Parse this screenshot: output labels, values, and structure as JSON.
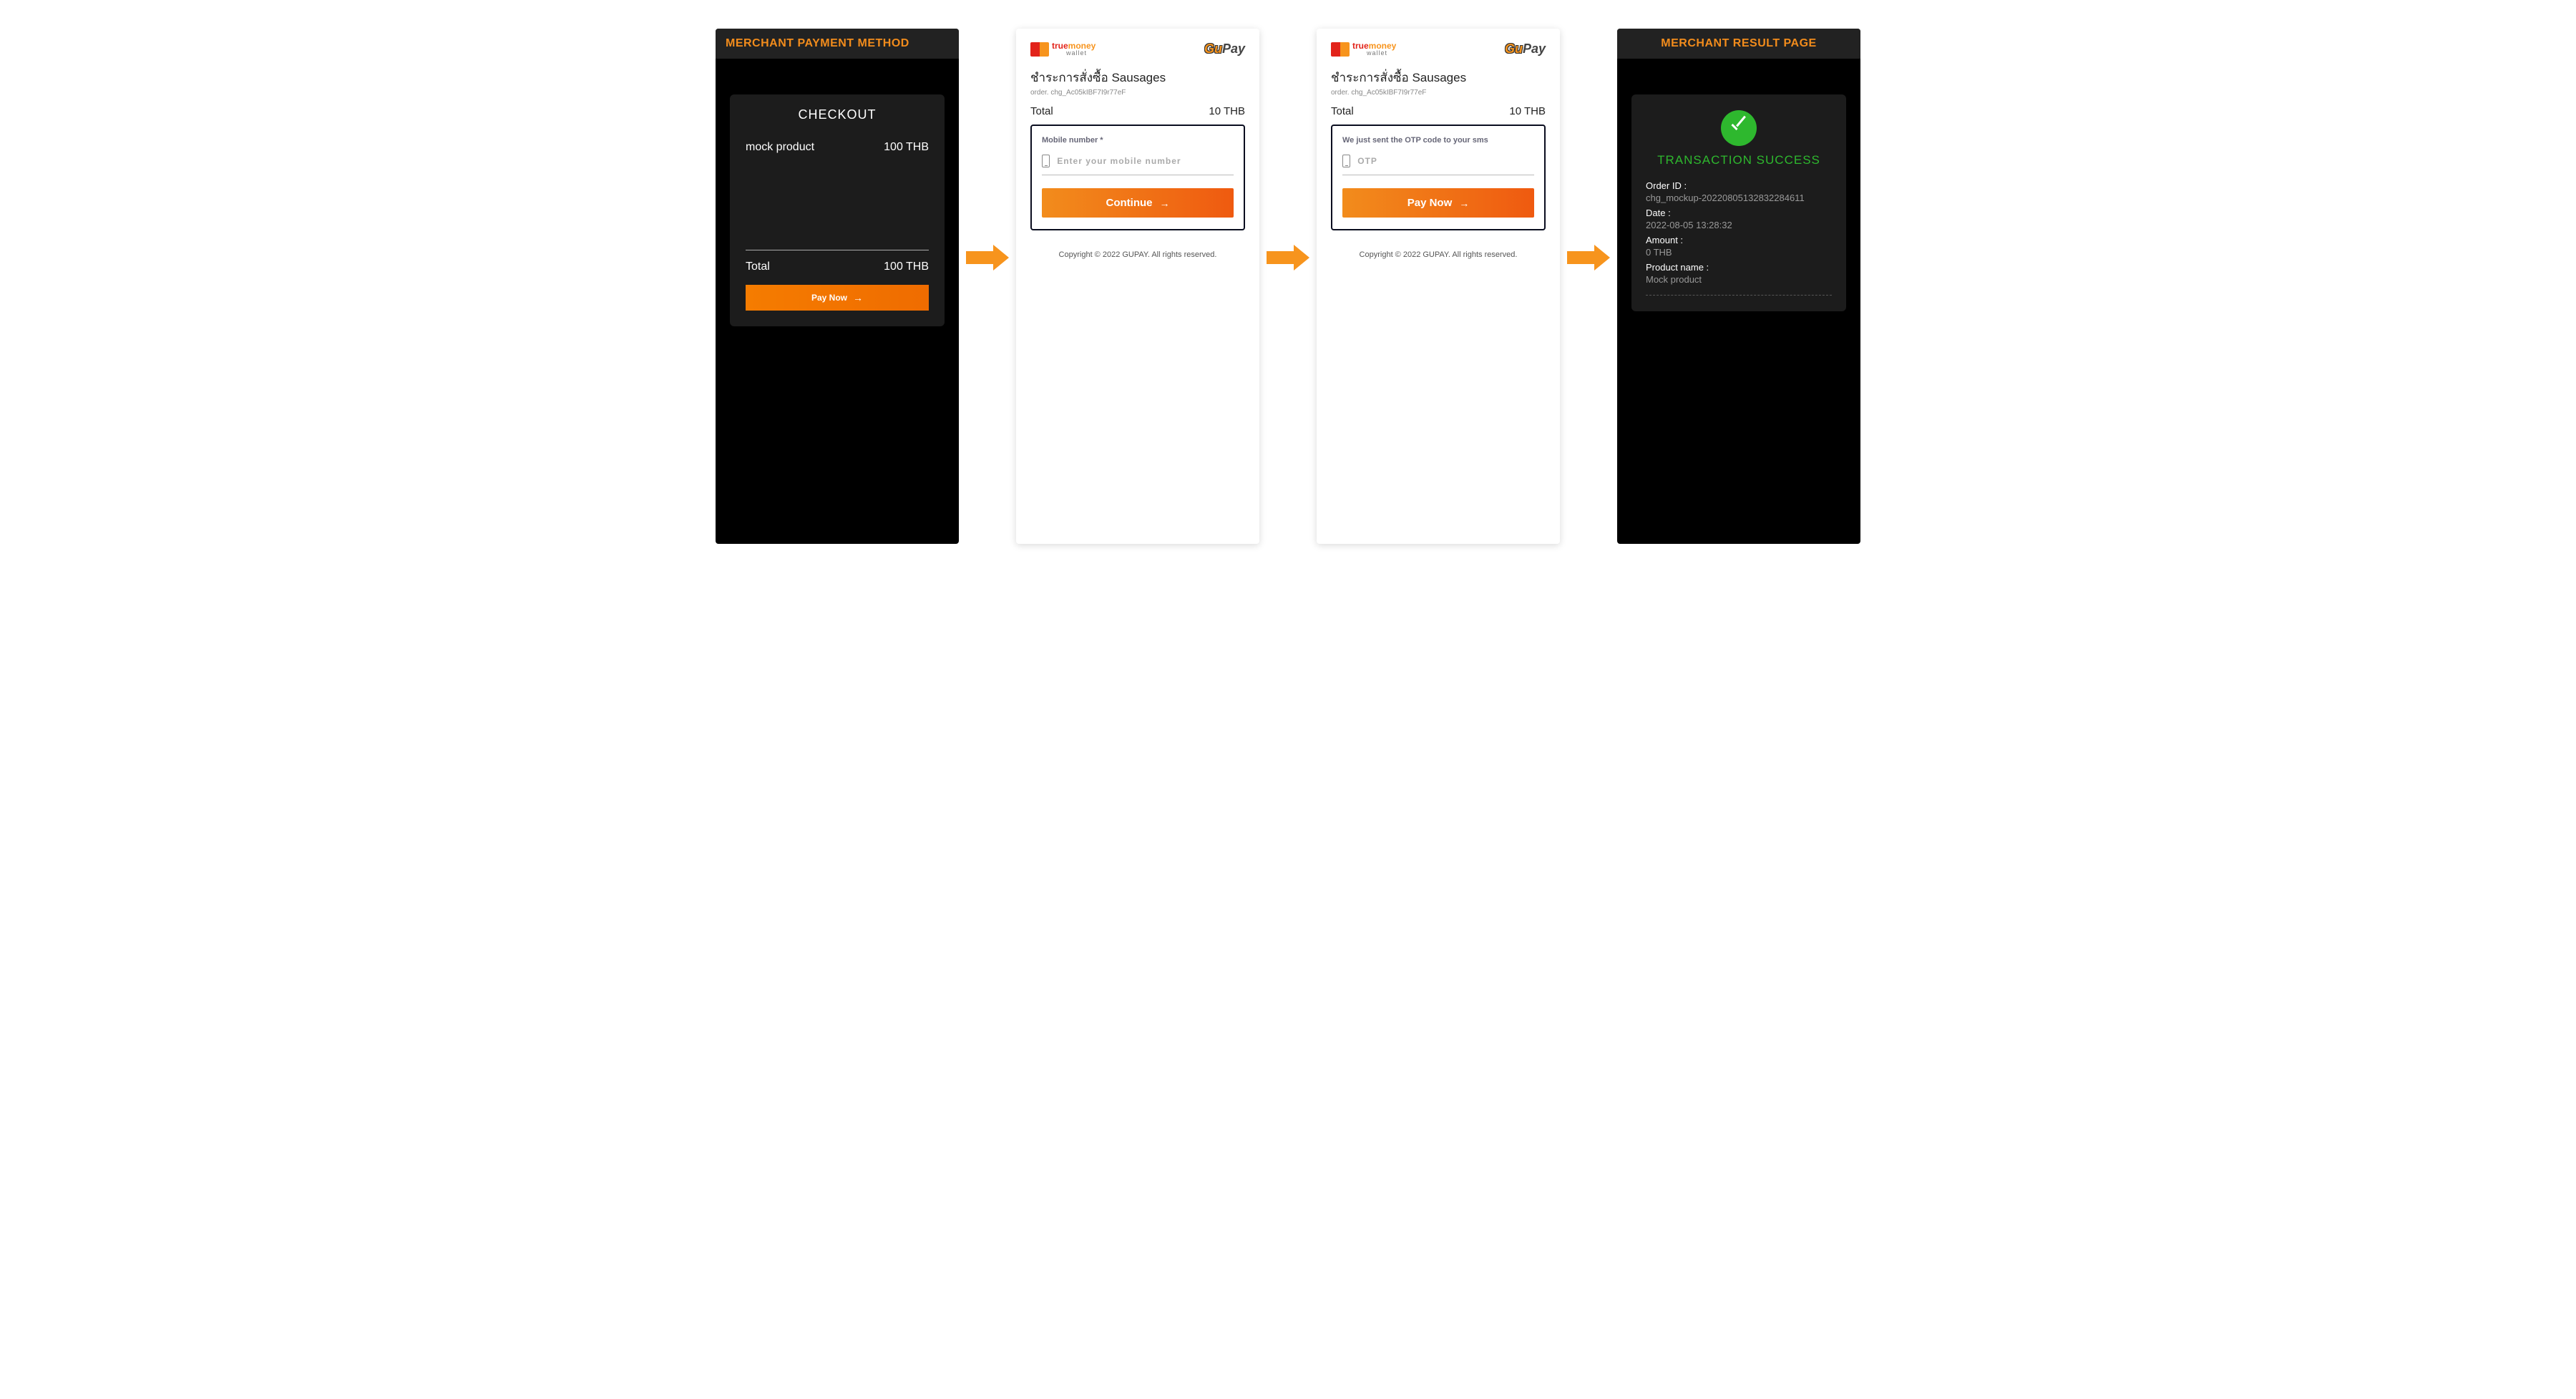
{
  "panel1": {
    "title": "MERCHANT PAYMENT METHOD",
    "checkout_heading": "CHECKOUT",
    "product_name": "mock product",
    "product_price": "100 THB",
    "total_label": "Total",
    "total_value": "100 THB",
    "pay_button": "Pay Now"
  },
  "panel2": {
    "tm_true": "true",
    "tm_money": "money",
    "tm_wallet": "wallet",
    "gupay_gu": "Gu",
    "gupay_pay": "Pay",
    "purchase_title": "ชำระการสั่งซื้อ Sausages",
    "order_id": "order. chg_Ac05kIBF7I9r77eF",
    "total_label": "Total",
    "total_value": "10 THB",
    "input_label": "Mobile number *",
    "input_placeholder": "Enter your mobile number",
    "button": "Continue",
    "copyright": "Copyright © 2022 GUPAY. All rights reserved."
  },
  "panel3": {
    "tm_true": "true",
    "tm_money": "money",
    "tm_wallet": "wallet",
    "gupay_gu": "Gu",
    "gupay_pay": "Pay",
    "purchase_title": "ชำระการสั่งซื้อ Sausages",
    "order_id": "order. chg_Ac05kIBF7I9r77eF",
    "total_label": "Total",
    "total_value": "10 THB",
    "input_label": "We just sent the OTP code to your sms",
    "input_placeholder": "OTP",
    "button": "Pay Now",
    "copyright": "Copyright © 2022 GUPAY. All rights reserved."
  },
  "panel4": {
    "title": "MERCHANT RESULT PAGE",
    "success": "TRANSACTION SUCCESS",
    "order_id_label": "Order ID :",
    "order_id_value": "chg_mockup-20220805132832284611",
    "date_label": "Date :",
    "date_value": "2022-08-05 13:28:32",
    "amount_label": "Amount :",
    "amount_value": "0 THB",
    "product_name_label": "Product name :",
    "product_name_value": "Mock product"
  }
}
